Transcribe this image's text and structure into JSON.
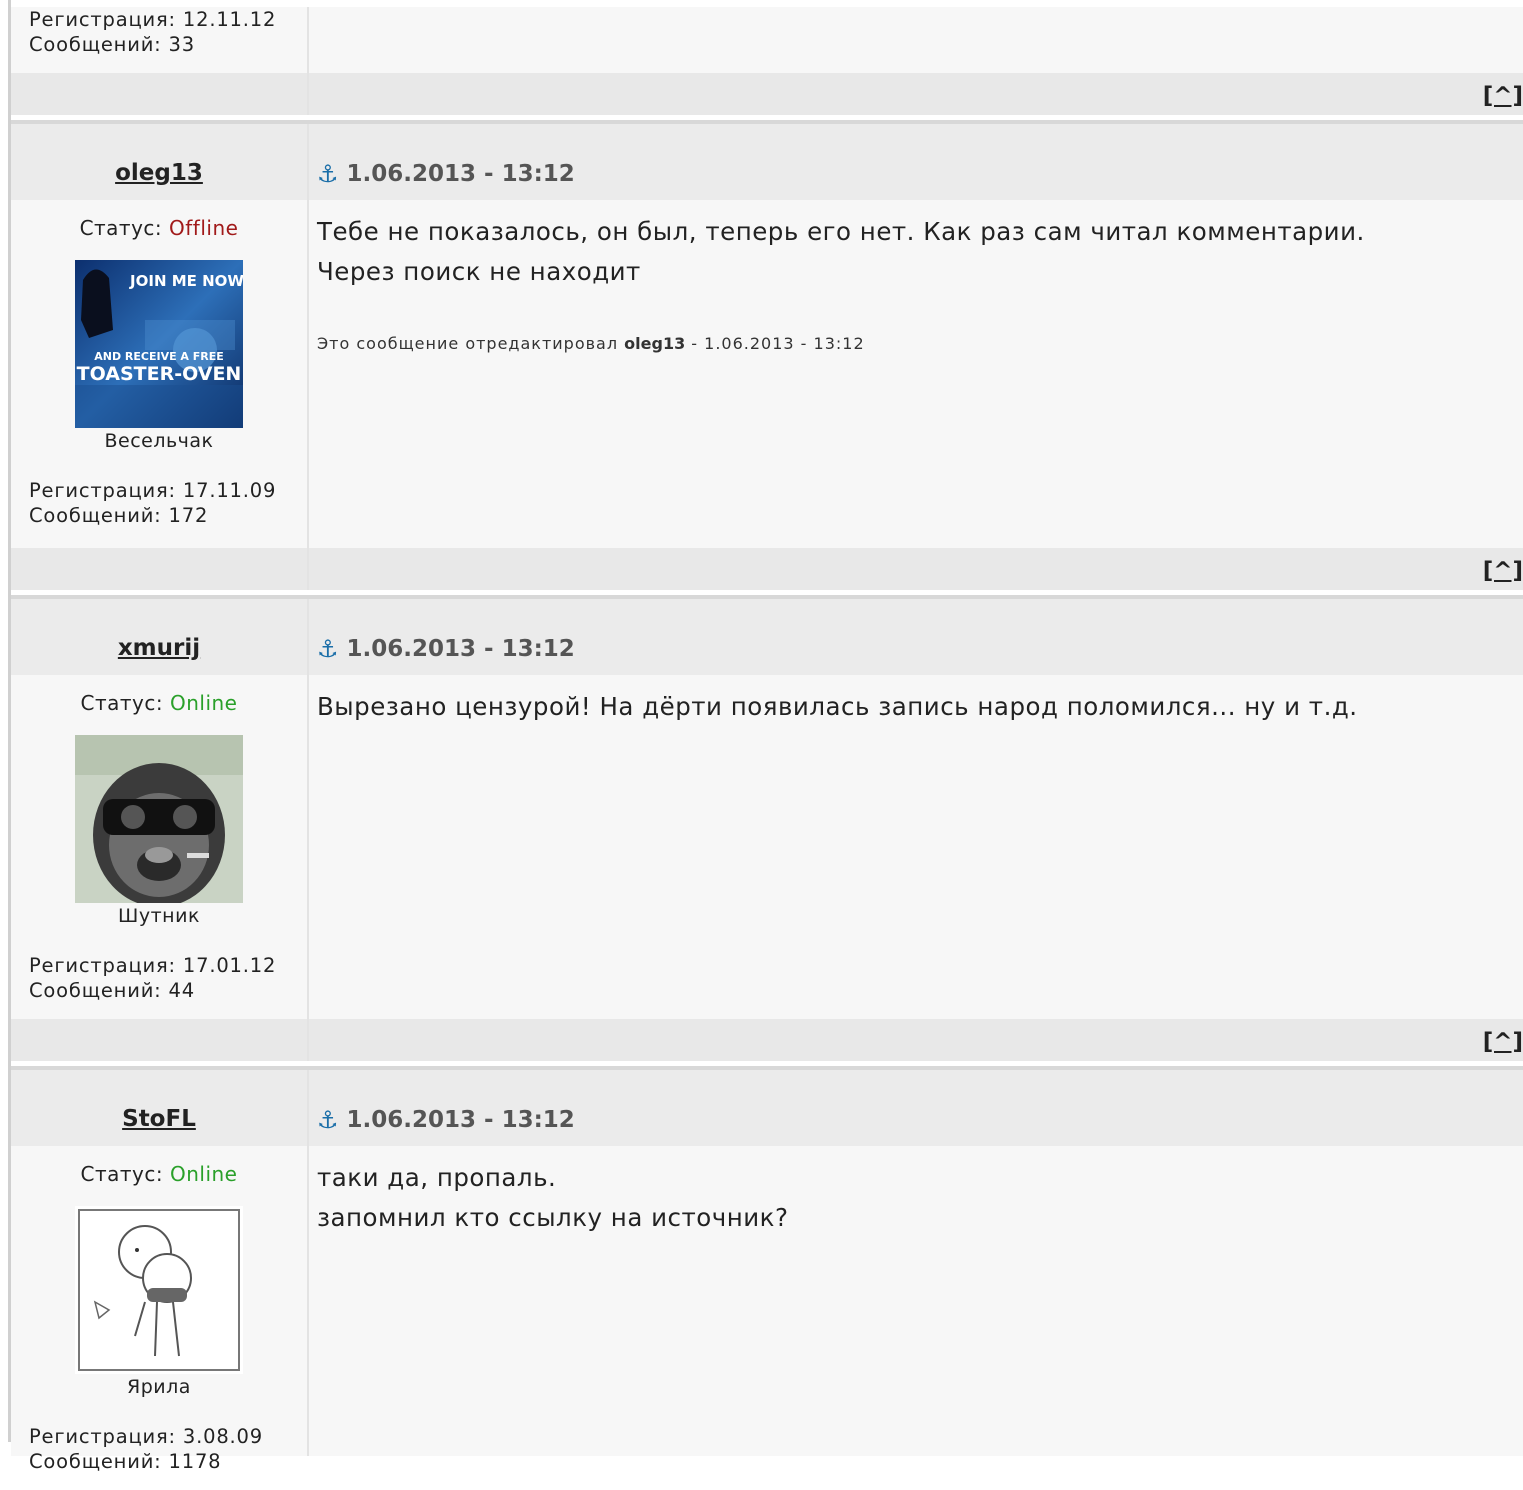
{
  "top_partial": {
    "registration": "Регистрация: 12.11.12",
    "messages": "Сообщений: 33",
    "up_link": "[^]"
  },
  "labels": {
    "status_prefix": "Статус: ",
    "edit_prefix": "Это сообщение отредактировал ",
    "up_link": "[^]"
  },
  "posts": [
    {
      "username": "oleg13",
      "date": "1.06.2013 - 13:12",
      "status": "Offline",
      "rank": "Весельчак",
      "registration": "Регистрация: 17.11.09",
      "messages": "Сообщений: 172",
      "text_lines": [
        "Тебе не показалось, он был, теперь его нет. Как раз сам читал комментарии.",
        "Через поиск не находит"
      ],
      "edit_user": "oleg13",
      "edit_suffix": " - 1.06.2013 - 13:12",
      "avatar_text_top": "JOIN ME NOW",
      "avatar_text_mid": "AND RECEIVE A FREE",
      "avatar_text_bottom": "TOASTER-OVEN"
    },
    {
      "username": "xmurij",
      "date": "1.06.2013 - 13:12",
      "status": "Online",
      "rank": "Шутник",
      "registration": "Регистрация: 17.01.12",
      "messages": "Сообщений: 44",
      "text_lines": [
        "Вырезано цензурой! На дёрти появилась запись народ поломился... ну и т.д."
      ]
    },
    {
      "username": "StoFL",
      "date": "1.06.2013 - 13:12",
      "status": "Online",
      "rank": "Ярила",
      "registration": "Регистрация: 3.08.09",
      "messages": "Сообщений: 1178",
      "text_lines": [
        "таки да, пропаль.",
        "запомнил кто ссылку на источник?"
      ]
    }
  ],
  "colors": {
    "offline": "#a11a1a",
    "online": "#2aa02a",
    "anchor": "#1a6ea8"
  }
}
